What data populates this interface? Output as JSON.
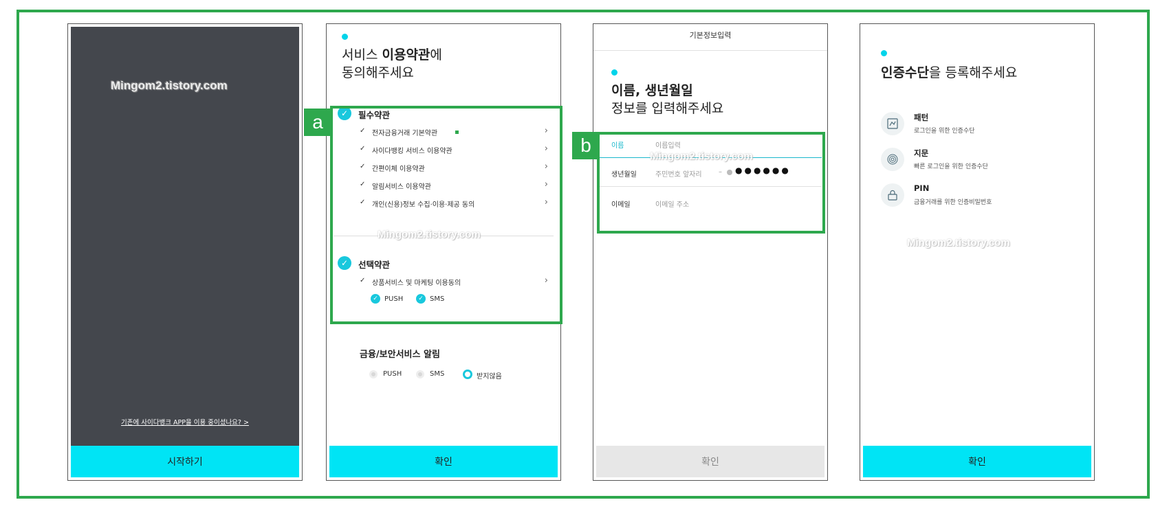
{
  "watermark": "Mingom2.tistory.com",
  "screen1": {
    "existing_link": "기존에 사이다뱅크 APP을 이용 중이셨나요? >",
    "start_button": "시작하기"
  },
  "screen2": {
    "title_prefix": "서비스 ",
    "title_bold": "이용약관",
    "title_suffix": "에",
    "title_line2": "동의해주세요",
    "badge": "a",
    "required_title": "필수약관",
    "required_terms": [
      "전자금융거래 기본약관",
      "사이다뱅킹 서비스 이용약관",
      "간편이체 이용약관",
      "알림서비스 이용약관",
      "개인(신용)정보 수집·이용·제공 동의"
    ],
    "optional_title": "선택약관",
    "optional_terms": [
      "상품서비스 및 마케팅 이용동의"
    ],
    "optional_channels": [
      "PUSH",
      "SMS"
    ],
    "notice_title": "금융/보안서비스 알림",
    "notice_options": [
      "PUSH",
      "SMS",
      "받지않음"
    ],
    "confirm_button": "확인"
  },
  "screen3": {
    "header": "기본정보입력",
    "title_line1": "이름, 생년월일",
    "title_line2": "정보를 입력해주세요",
    "badge": "b",
    "fields": [
      {
        "label": "이름",
        "placeholder": "이름입력"
      },
      {
        "label": "생년월일",
        "placeholder": "주민번호 앞자리"
      },
      {
        "label": "이메일",
        "placeholder": "이메일 주소"
      }
    ],
    "birth_dash": "–",
    "birth_masked": "●●●●●●",
    "confirm_button": "확인"
  },
  "screen4": {
    "title_bold": "인증수단",
    "title_suffix": "을 등록해주세요",
    "methods": [
      {
        "title": "패턴",
        "desc": "로그인을 위한 인증수단",
        "icon": "pattern-icon"
      },
      {
        "title": "지문",
        "desc": "빠른 로그인을 위한 인증수단",
        "icon": "fingerprint-icon"
      },
      {
        "title": "PIN",
        "desc": "금융거래를 위한 인증비밀번호",
        "icon": "pin-lock-icon"
      }
    ],
    "confirm_button": "확인"
  },
  "colors": {
    "accent_cyan": "#00e4f5",
    "check_cyan": "#19c8dd",
    "annotation_green": "#2ea84d",
    "splash_dark": "#44474d"
  }
}
